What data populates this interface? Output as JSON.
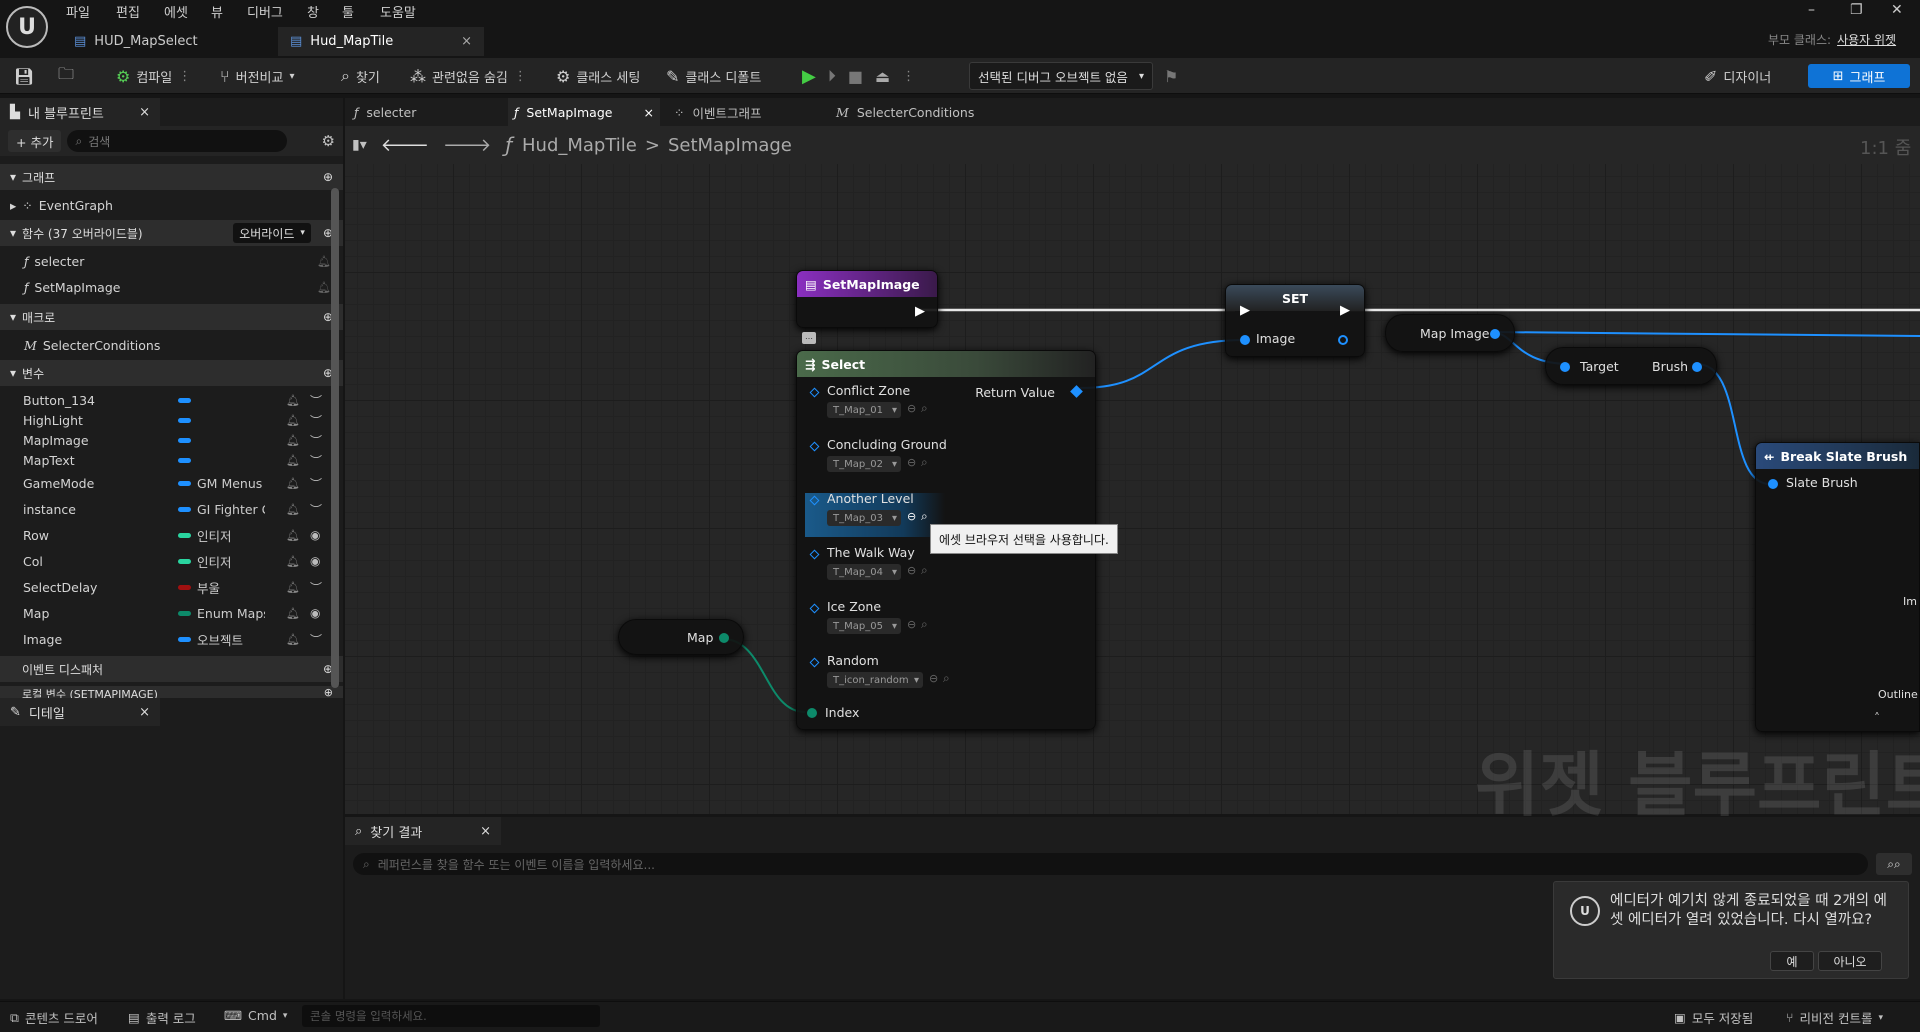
{
  "menu": [
    "파일",
    "편집",
    "에셋",
    "뷰",
    "디버그",
    "창",
    "툴",
    "도움말"
  ],
  "doc_tabs": [
    {
      "label": "HUD_MapSelect"
    },
    {
      "label": "Hud_MapTile"
    }
  ],
  "parent_class": {
    "label": "부모 클래스:",
    "value": "사용자 위젯"
  },
  "toolbar": {
    "compile": "컴파일",
    "diff": "버전비교",
    "find": "찾기",
    "hide_unrelated": "관련없음 숨김",
    "class_settings": "클래스 세팅",
    "class_defaults": "클래스 디폴트",
    "debug_object": "선택된 디버그 오브젝트 없음",
    "designer": "디자이너",
    "graph": "그래프"
  },
  "my_blueprint": {
    "tab": "내 블루프린트",
    "add": "+ 추가",
    "search_placeholder": "검색",
    "sections": {
      "graph": "그래프",
      "functions": "함수 (37 오버라이드블)",
      "override": "오버라이드",
      "macros": "매크로",
      "variables": "변수",
      "event_dispatchers": "이벤트 디스패처",
      "local_vars": "로컬 변수 (SETMAPIMAGE)"
    },
    "graphs": [
      "EventGraph"
    ],
    "functions": [
      "selecter",
      "SetMapImage"
    ],
    "macros": [
      "SelecterConditions"
    ],
    "variables": [
      {
        "name": "Button_134",
        "type": "",
        "color": "#1e90ff",
        "eye": false
      },
      {
        "name": "HighLight",
        "type": "",
        "color": "#1e90ff",
        "eye": false
      },
      {
        "name": "MapImage",
        "type": "",
        "color": "#1e90ff",
        "eye": false
      },
      {
        "name": "MapText",
        "type": "",
        "color": "#1e90ff",
        "eye": false
      },
      {
        "name": "GameMode",
        "type": "GM Menus",
        "color": "#1e90ff",
        "eye": false
      },
      {
        "name": "instance",
        "type": "GI Fighter Game",
        "color": "#1e90ff",
        "eye": false
      },
      {
        "name": "Row",
        "type": "인티저",
        "color": "#2ad5a0",
        "eye": true
      },
      {
        "name": "Col",
        "type": "인티저",
        "color": "#2ad5a0",
        "eye": true
      },
      {
        "name": "SelectDelay",
        "type": "부울",
        "color": "#a01010",
        "eye": false
      },
      {
        "name": "Map",
        "type": "Enum Maps",
        "color": "#0d8a6a",
        "eye": true
      },
      {
        "name": "Image",
        "type": "오브젝트",
        "color": "#1e90ff",
        "eye": false
      }
    ]
  },
  "details_tab": "디테일",
  "graph_tabs": [
    {
      "label": "selecter"
    },
    {
      "label": "SetMapImage"
    },
    {
      "label": "이벤트그래프"
    },
    {
      "label": "SelecterConditions"
    }
  ],
  "breadcrumb": {
    "root": "Hud_MapTile",
    "sep": ">",
    "leaf": "SetMapImage"
  },
  "zoom": "1:1 줌",
  "watermark": "위젯 블루프린트",
  "nodes": {
    "entry": {
      "title": "SetMapImage"
    },
    "select": {
      "title": "Select",
      "return_value": "Return Value",
      "index": "Index",
      "options": [
        {
          "label": "Conflict Zone",
          "value": "T_Map_01"
        },
        {
          "label": "Concluding Ground",
          "value": "T_Map_02"
        },
        {
          "label": "Another Level",
          "value": "T_Map_03"
        },
        {
          "label": "The Walk Way",
          "value": "T_Map_04"
        },
        {
          "label": "Ice Zone",
          "value": "T_Map_05"
        },
        {
          "label": "Random",
          "value": "T_icon_random"
        }
      ]
    },
    "set": {
      "title": "SET",
      "pin": "Image"
    },
    "map_image": {
      "title": "Map Image"
    },
    "set_brush": {
      "target": "Target",
      "brush": "Brush"
    },
    "map_var": {
      "title": "Map"
    },
    "break_brush": {
      "title": "Break Slate Brush",
      "pin": "Slate Brush",
      "right1": "Im",
      "right2": "Outline"
    }
  },
  "tooltip": "에셋 브라우저 선택을 사용합니다.",
  "find_results": {
    "tab": "찾기 결과",
    "placeholder": "레퍼런스를 찾을 함수 또는 이벤트 이름을 입력하세요..."
  },
  "toast": {
    "message": "에디터가 예기치 않게 종료되었을 때 2개의 에셋 에디터가 열려 있었습니다. 다시 열까요?",
    "yes": "예",
    "no": "아니오"
  },
  "status": {
    "content_drawer": "콘텐츠 드로어",
    "output_log": "출력 로그",
    "cmd": "Cmd",
    "cmd_placeholder": "콘솔 명령을 입력하세요.",
    "save_all": "모두 저장됨",
    "revision": "리비전 컨트롤"
  }
}
